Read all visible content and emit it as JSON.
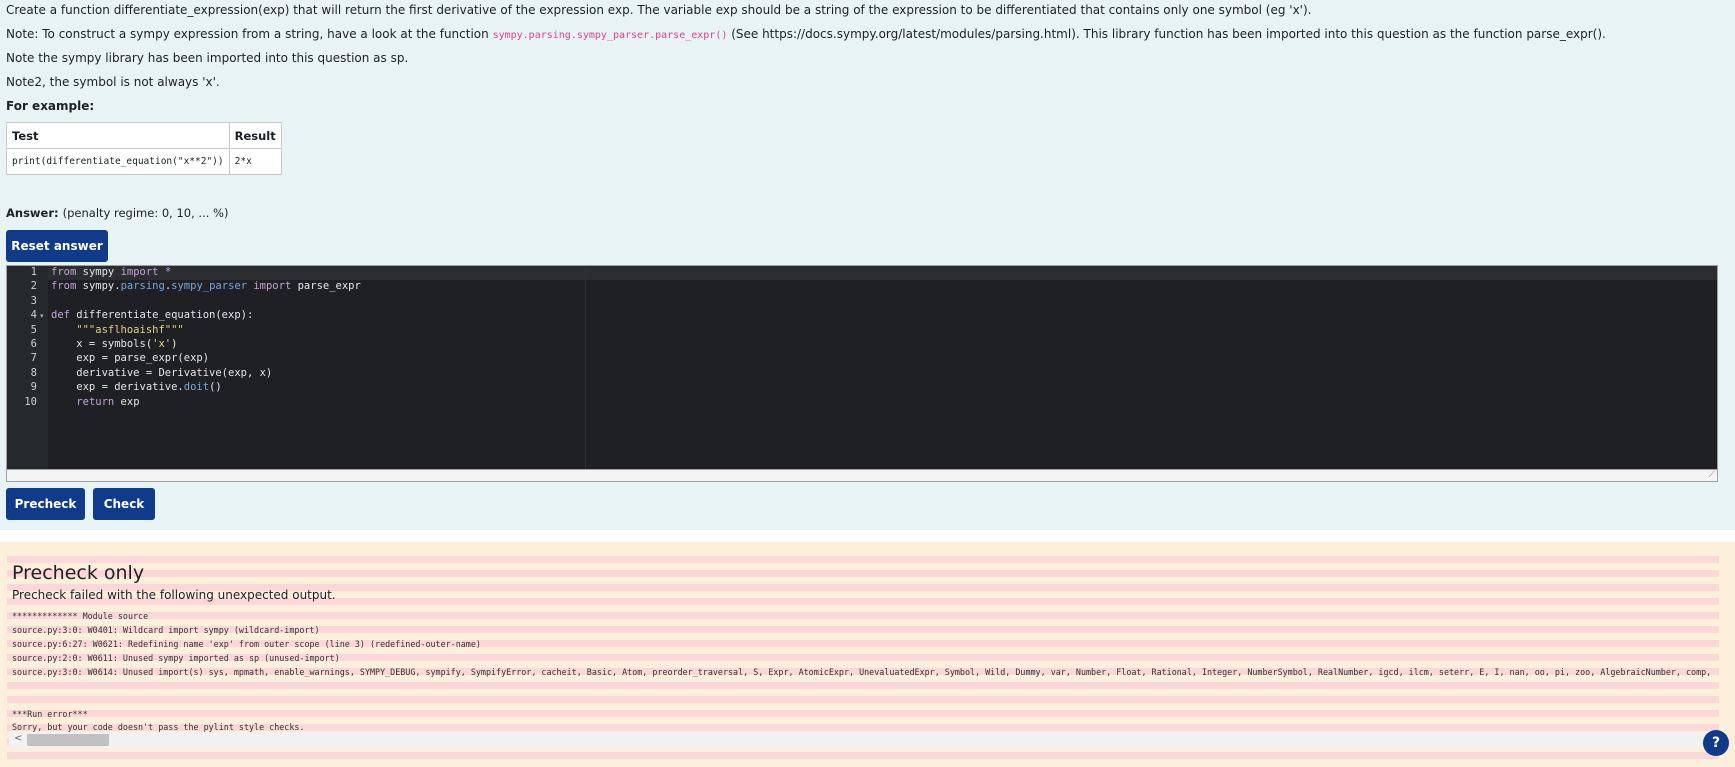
{
  "question": {
    "line1": "Create a function differentiate_expression(exp) that will return the first derivative of the expression exp. The variable exp should be a string of the expression to be differentiated that contains only one symbol (eg 'x').",
    "line2_pre": "Note: To construct a sympy expression from a string, have a look at the function ",
    "line2_code": "sympy.parsing.sympy_parser.parse_expr()",
    "line2_mid": " (See ",
    "line2_link": "https://docs.sympy.org/latest/modules/parsing.html",
    "line2_post": "). This library function has been imported into this question as the function parse_expr().",
    "line3": "Note the sympy library has been imported into this question as sp.",
    "line4": "Note2, the symbol is not always 'x'.",
    "for_example": "For example:"
  },
  "example_table": {
    "headers": [
      "Test",
      "Result"
    ],
    "rows": [
      [
        "print(differentiate_equation(\"x**2\"))",
        "2*x"
      ]
    ]
  },
  "answer": {
    "label": "Answer:",
    "penalty": "(penalty regime: 0, 10, ... %)"
  },
  "buttons": {
    "reset": "Reset answer",
    "precheck": "Precheck",
    "check": "Check",
    "help": "?"
  },
  "editor": {
    "line_numbers": [
      "1",
      "2",
      "3",
      "4",
      "5",
      "6",
      "7",
      "8",
      "9",
      "10"
    ],
    "lines": [
      [
        {
          "t": "from",
          "c": "kw"
        },
        {
          "t": " sympy ",
          "c": ""
        },
        {
          "t": "import",
          "c": "kw"
        },
        {
          "t": " *",
          "c": "kw"
        }
      ],
      [
        {
          "t": "from",
          "c": "kw"
        },
        {
          "t": " sympy.",
          "c": ""
        },
        {
          "t": "parsing",
          "c": "mod"
        },
        {
          "t": ".",
          "c": ""
        },
        {
          "t": "sympy_parser",
          "c": "mod"
        },
        {
          "t": " ",
          "c": ""
        },
        {
          "t": "import",
          "c": "kw"
        },
        {
          "t": " parse_expr",
          "c": ""
        }
      ],
      [],
      [
        {
          "t": "def",
          "c": "kw"
        },
        {
          "t": " differentiate_equation(exp):",
          "c": ""
        }
      ],
      [
        {
          "t": "    \"\"\"asflhoaishf\"\"\"",
          "c": "str"
        }
      ],
      [
        {
          "t": "    x = symbols(",
          "c": ""
        },
        {
          "t": "'x'",
          "c": "str"
        },
        {
          "t": ")",
          "c": ""
        }
      ],
      [
        {
          "t": "    exp = parse_expr(exp)",
          "c": ""
        }
      ],
      [
        {
          "t": "    derivative = Derivative(exp, x)",
          "c": ""
        }
      ],
      [
        {
          "t": "    exp = derivative.",
          "c": ""
        },
        {
          "t": "doit",
          "c": "mod"
        },
        {
          "t": "()",
          "c": ""
        }
      ],
      [
        {
          "t": "    ",
          "c": ""
        },
        {
          "t": "return",
          "c": "kw"
        },
        {
          "t": " exp",
          "c": ""
        }
      ]
    ]
  },
  "outcome": {
    "title": "Precheck only",
    "message": "Precheck failed with the following unexpected output.",
    "output_lines": [
      "************* Module source",
      "source.py:3:0: W0401: Wildcard import sympy (wildcard-import)",
      "source.py:6:27: W0621: Redefining name 'exp' from outer scope (line 3) (redefined-outer-name)",
      "source.py:2:0: W0611: Unused sympy imported as sp (unused-import)",
      "source.py:3:0: W0614: Unused import(s) sys, mpmath, enable_warnings, SYMPY_DEBUG, sympify, SympifyError, cacheit, Basic, Atom, preorder_traversal, S, Expr, AtomicExpr, UnevaluatedExpr, Symbol, Wild, Dummy, var, Number, Float, Rational, Integer, NumberSymbol, RealNumber, igcd, ilcm, seterr, E, I, nan, oo, pi, zoo, AlgebraicNumber, comp,",
      "***Run error***",
      "Sorry, but your code doesn't pass the pylint style checks."
    ]
  },
  "colors": {
    "button_bg": "#0f3b8a",
    "question_bg": "#e7f3f5",
    "outcome_bg": "#fcefdc",
    "stripe": "#fcd7d7",
    "editor_bg": "#1f2023"
  }
}
